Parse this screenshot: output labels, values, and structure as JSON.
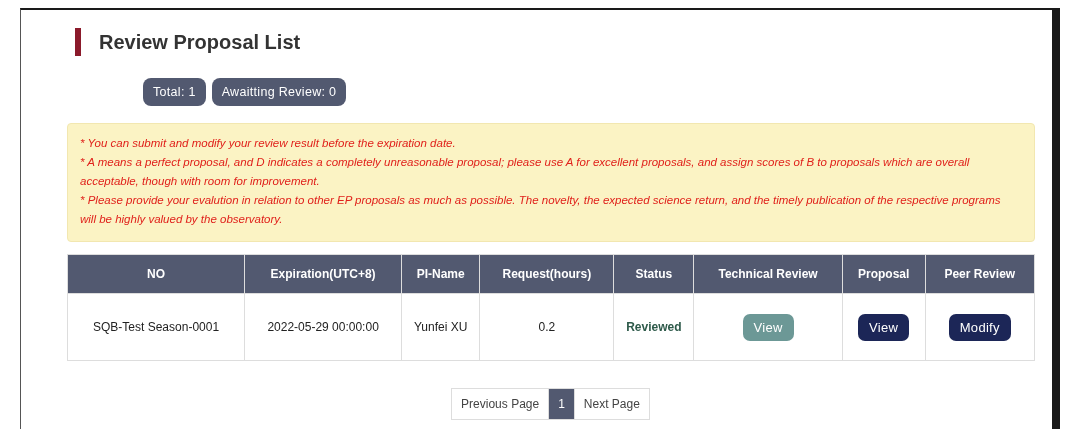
{
  "title": "Review Proposal List",
  "badges": [
    "Total: 1",
    "Awaitting Review: 0"
  ],
  "notes": [
    "* You can submit and modify your review result before the expiration date.",
    "* A means a perfect proposal, and D indicates a completely unreasonable proposal; please use A for excellent proposals, and assign scores of B to proposals which are overall acceptable, though with room for improvement.",
    "* Please provide your evalution in relation to other EP proposals as much as possible. The novelty, the expected science return, and the timely publication of the respective programs will be highly valued by the observatory."
  ],
  "table": {
    "columns": [
      "NO",
      "Expiration(UTC+8)",
      "PI-Name",
      "Request(hours)",
      "Status",
      "Technical Review",
      "Proposal",
      "Peer Review"
    ],
    "rows": [
      {
        "cells": [
          {
            "kind": "text",
            "text": "SQB-Test Season-0001"
          },
          {
            "kind": "text",
            "text": "2022-05-29 00:00:00"
          },
          {
            "kind": "text",
            "text": "Yunfei XU"
          },
          {
            "kind": "text",
            "text": "0.2"
          },
          {
            "kind": "status",
            "text": "Reviewed"
          },
          {
            "kind": "muted",
            "text": "View"
          },
          {
            "kind": "button",
            "text": "View"
          },
          {
            "kind": "button",
            "text": "Modify"
          }
        ]
      }
    ]
  },
  "pagination": {
    "previous": "Previous Page",
    "pages": [
      {
        "label": "1",
        "selected": true
      }
    ],
    "next": "Next Page"
  }
}
